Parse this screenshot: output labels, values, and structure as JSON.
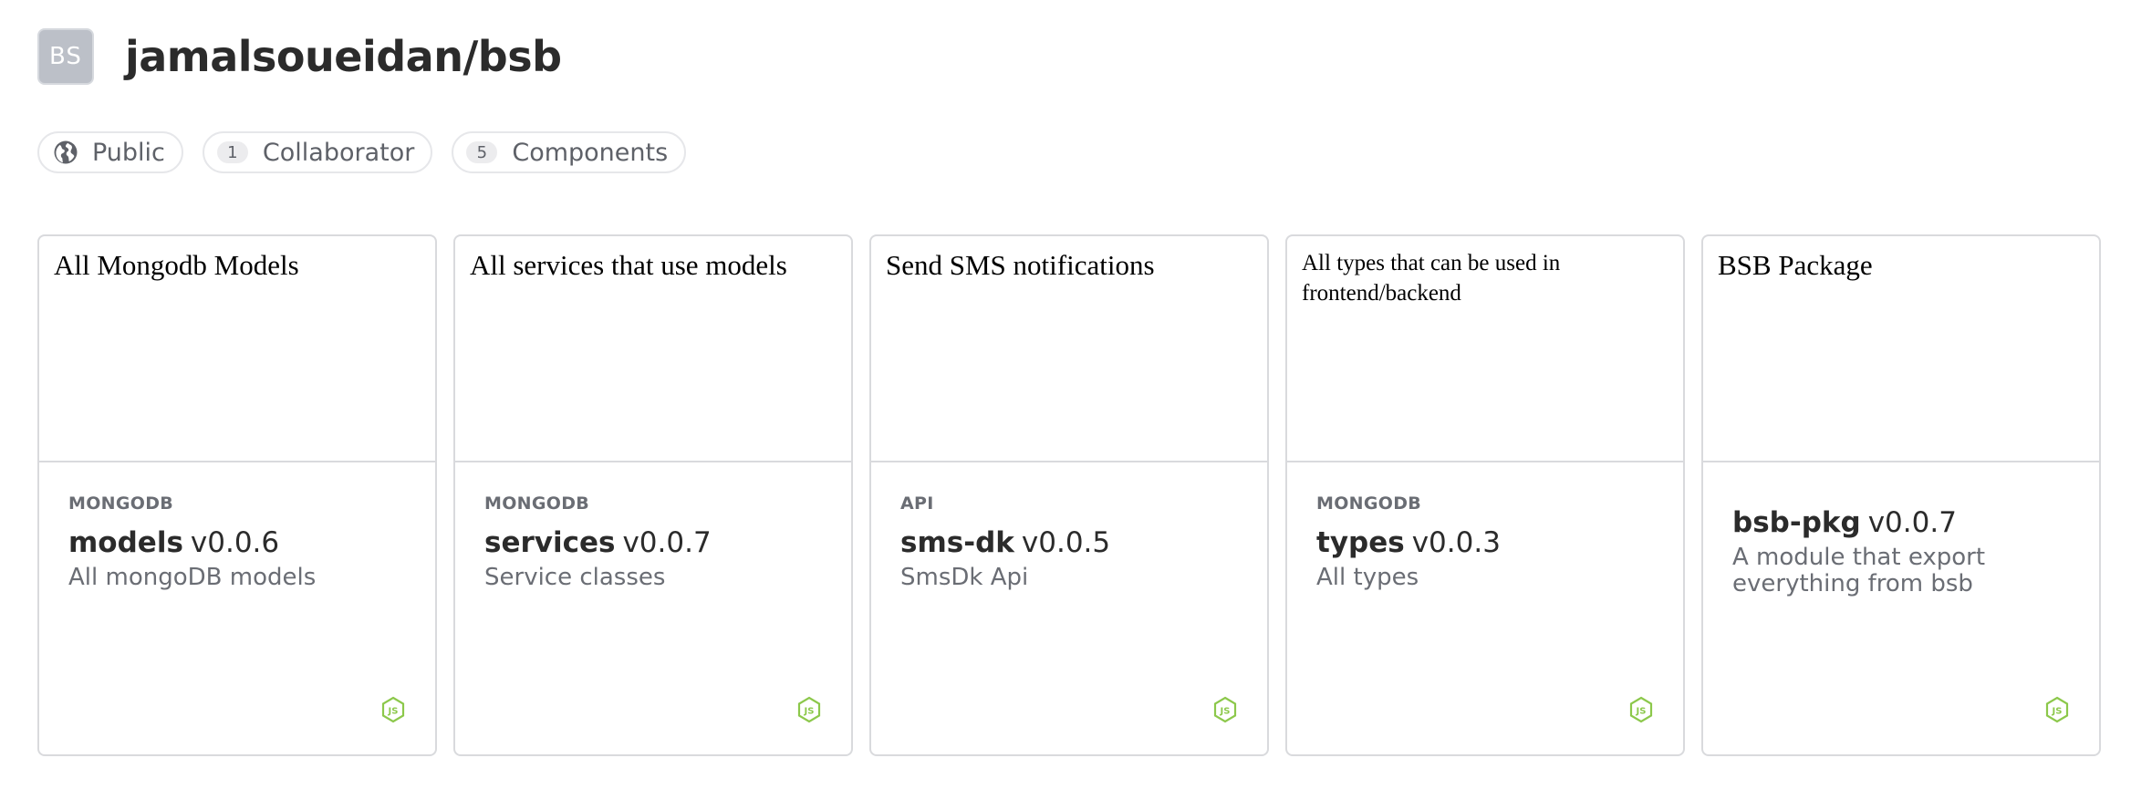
{
  "scope": {
    "avatar_initials": "BS",
    "title": "jamalsoueidan/bsb"
  },
  "pills": {
    "visibility": "Public",
    "collaborators_count": "1",
    "collaborators_label": "Collaborator",
    "components_count": "5",
    "components_label": "Components"
  },
  "colors": {
    "accent_js": "#8cc84b",
    "avatar_bg": "#bcc0c8",
    "border": "#d9dadd"
  },
  "cards": [
    {
      "preview_text": "All Mongodb Models",
      "namespace": "MONGODB",
      "name": "models",
      "version": "v0.0.6",
      "description": "All mongoDB models",
      "env_icon": "nodejs-icon"
    },
    {
      "preview_text": "All services that use models",
      "namespace": "MONGODB",
      "name": "services",
      "version": "v0.0.7",
      "description": "Service classes",
      "env_icon": "nodejs-icon"
    },
    {
      "preview_text": "Send SMS notifications",
      "namespace": "API",
      "name": "sms-dk",
      "version": "v0.0.5",
      "description": "SmsDk Api",
      "env_icon": "nodejs-icon"
    },
    {
      "preview_text": "All types that can be used in frontend/backend",
      "namespace": "MONGODB",
      "name": "types",
      "version": "v0.0.3",
      "description": "All types",
      "env_icon": "nodejs-icon"
    },
    {
      "preview_text": "BSB Package",
      "namespace": "",
      "name": "bsb-pkg",
      "version": "v0.0.7",
      "description": "A module that export everything from bsb",
      "env_icon": "nodejs-icon"
    }
  ]
}
